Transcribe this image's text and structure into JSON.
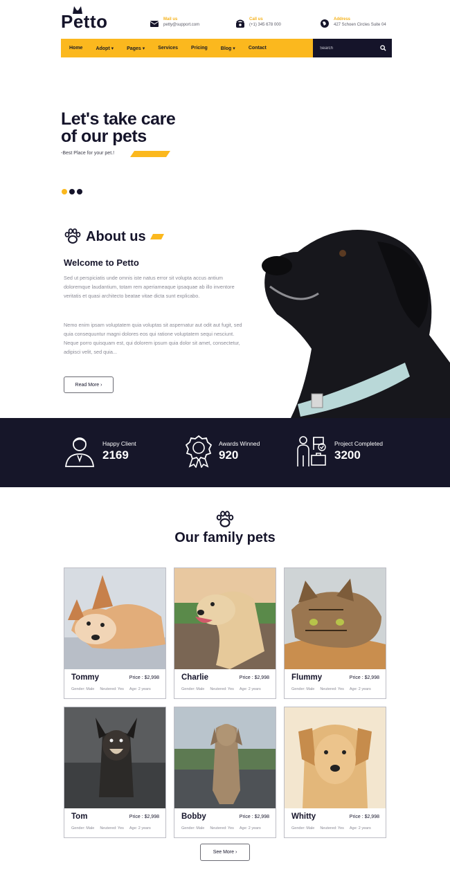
{
  "brand": {
    "name": "Petto"
  },
  "contacts": [
    {
      "label": "Mail us",
      "value": "petty@support.com",
      "icon": "mail-icon"
    },
    {
      "label": "Call us",
      "value": "(+1) 345 678 000",
      "icon": "phone-icon"
    },
    {
      "label": "Address",
      "value": "427 Schoen Circles Suite 04",
      "icon": "location-icon"
    }
  ],
  "nav": {
    "items": [
      "Home",
      "Adopt",
      "Pages",
      "Services",
      "Pricing",
      "Blog",
      "Contact"
    ],
    "search_placeholder": "Search"
  },
  "hero": {
    "title_line1": "Let's take care",
    "title_line2": "of our pets",
    "subtitle": "-Best Place for your pet.!",
    "slides": 3,
    "active_slide": 1
  },
  "about": {
    "heading": "About us",
    "welcome": "Welcome to Petto",
    "para1": "Sed ut perspiciatis unde omnis iste natus error sit volupta accus antium doloremque laudantium, totam rem aperiameaque ipsaquae ab illo inventore veritatis et quasi architecto beatae vitae dicta sunt explicabo.",
    "para2": "Nemo enim ipsam voluptatem quia voluptas sit aspernatur aut odit aut fugit, sed quia consequuntur magni dolores eos qui ratione voluptatem sequi nesciunt. Neque porro quisquam est, qui dolorem ipsum quia dolor sit amet, consectetur, adipisci velit, sed quia...",
    "button": "Read More ›"
  },
  "stats": [
    {
      "label": "Happy Client",
      "value": "2169",
      "icon": "client-icon"
    },
    {
      "label": "Awards Winned",
      "value": "920",
      "icon": "award-icon"
    },
    {
      "label": "Project Completed",
      "value": "3200",
      "icon": "project-icon"
    }
  ],
  "pets_section": {
    "title": "Our family pets",
    "button": "See More ›"
  },
  "pets": [
    {
      "name": "Tommy",
      "price": "Price : $2,998",
      "gender": "Gender: Male",
      "neutered": "Neutered: Yes",
      "age": "Age: 2 years"
    },
    {
      "name": "Charlie",
      "price": "Price : $2,998",
      "gender": "Gender: Male",
      "neutered": "Neutered: Yes",
      "age": "Age: 2 years"
    },
    {
      "name": "Flummy",
      "price": "Price : $2,998",
      "gender": "Gender: Male",
      "neutered": "Neutered: Yes",
      "age": "Age: 2 years"
    },
    {
      "name": "Tom",
      "price": "Price : $2,998",
      "gender": "Gender: Male",
      "neutered": "Neutered: Yes",
      "age": "Age: 2 years"
    },
    {
      "name": "Bobby",
      "price": "Price : $2,998",
      "gender": "Gender: Male",
      "neutered": "Neutered: Yes",
      "age": "Age: 2 years"
    },
    {
      "name": "Whitty",
      "price": "Price : $2,998",
      "gender": "Gender: Male",
      "neutered": "Neutered: Yes",
      "age": "Age: 2 years"
    }
  ],
  "colors": {
    "accent": "#fbb81e",
    "dark": "#161629"
  }
}
